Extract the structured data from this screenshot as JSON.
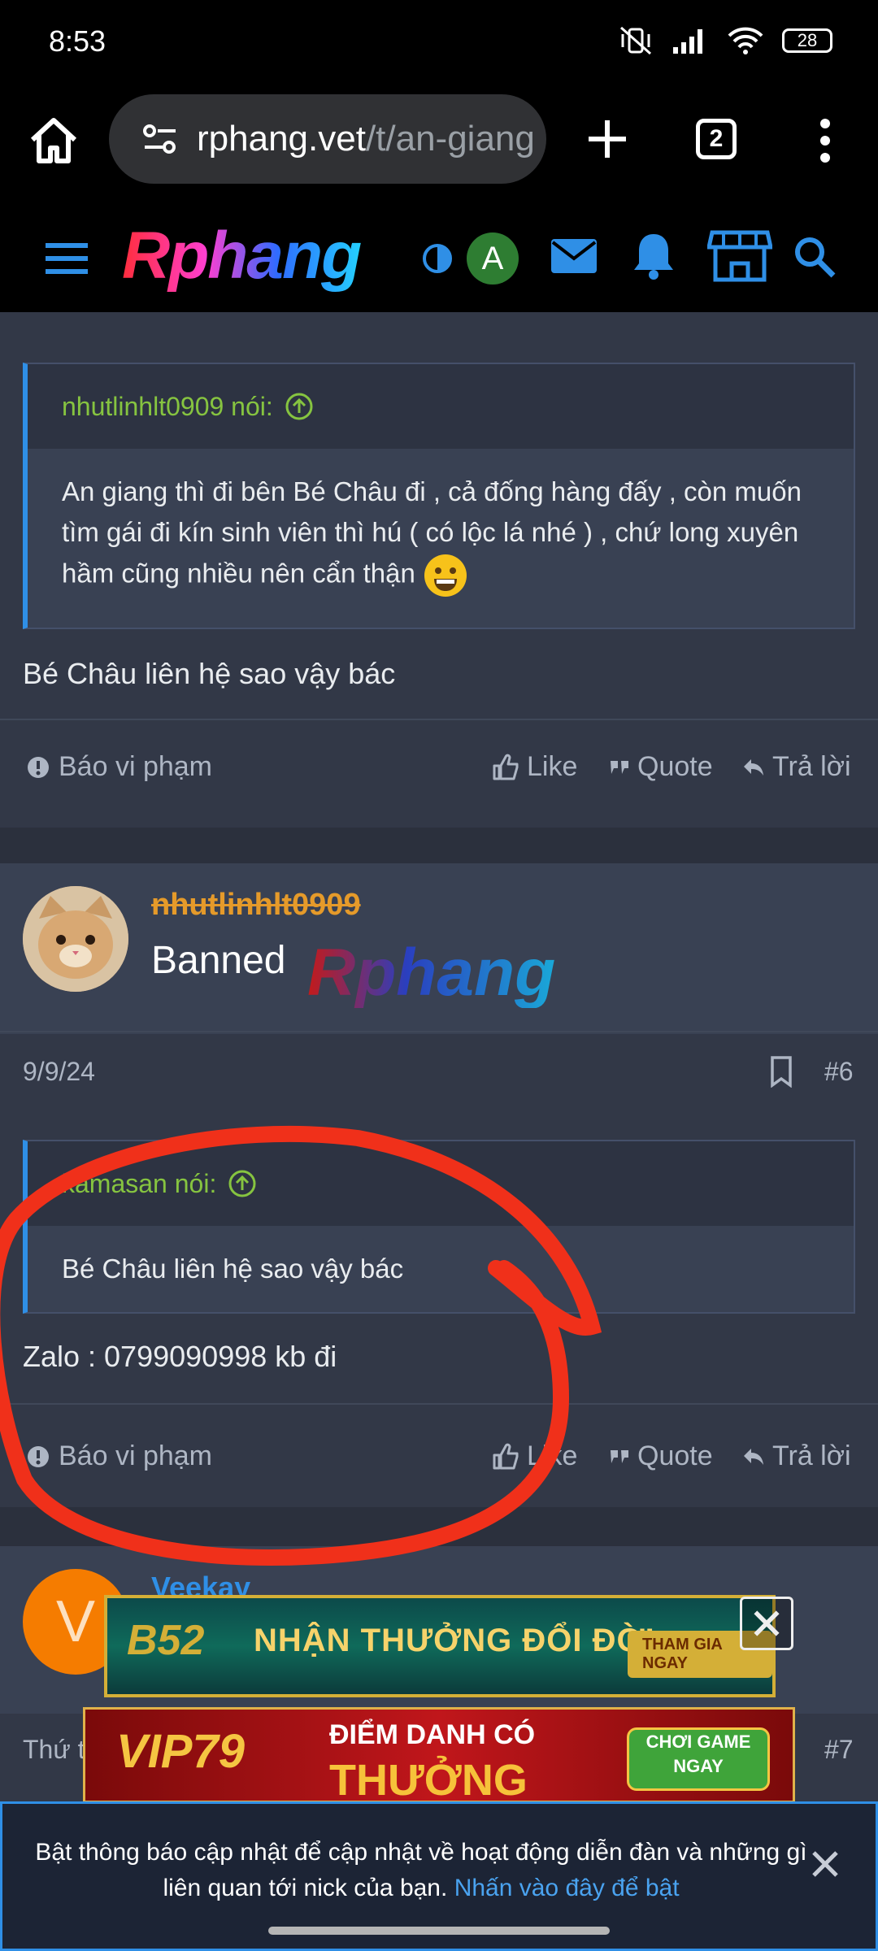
{
  "status_bar": {
    "time": "8:53",
    "battery": "28"
  },
  "browser": {
    "url_domain": "rphang.vet",
    "url_path": "/t/an-giang",
    "tab_count": "2"
  },
  "site": {
    "logo": "Rphang",
    "user_initial": "A"
  },
  "post1": {
    "quote_author": "nhutlinhlt0909 nói:",
    "quote_text": "An giang thì đi bên Bé Châu đi , cả đống hàng đấy , còn muốn tìm gái đi kín sinh viên thì hú ( có lộc lá nhé ) , chứ long xuyên hầm cũng nhiều nên cẩn thận",
    "reply": "Bé Châu liên hệ sao vậy bác",
    "actions": {
      "report": "Báo vi phạm",
      "like": "Like",
      "quote": "Quote",
      "reply": "Trả lời"
    }
  },
  "post2": {
    "username": "nhutlinhlt0909",
    "user_title": "Banned",
    "badge_logo": "Rphang",
    "date": "9/9/24",
    "post_number": "#6",
    "quote_author": "kamasan nói:",
    "quote_text": "Bé Châu liên hệ sao vậy bác",
    "reply": "Zalo : 0799090998 kb đi",
    "actions": {
      "report": "Báo vi phạm",
      "like": "Like",
      "quote": "Quote",
      "reply": "Trả lời"
    }
  },
  "post3": {
    "username": "Veekay",
    "avatar_initial": "V",
    "date_partial": "Thứ t",
    "post_number": "#7"
  },
  "ads": {
    "ad1": {
      "brand": "B52",
      "message": "NHẬN THƯỞNG ĐỔI ĐỜI",
      "cta": "THAM GIA NGAY"
    },
    "ad2": {
      "brand": "VIP79",
      "line1": "ĐIỂM DANH CÓ",
      "line2": "THƯỞNG",
      "cta": "CHƠI GAME NGAY"
    }
  },
  "notification": {
    "text": "Bật thông báo cập nhật để cập nhật về hoạt động diễn đàn và những gì liên quan tới nick của bạn.",
    "link": "Nhấn vào đây để bật"
  },
  "colors": {
    "accent": "#2f8fe6",
    "quote_author": "#86c440",
    "banned_user": "#e59a2a",
    "ink": "#f0301a"
  }
}
